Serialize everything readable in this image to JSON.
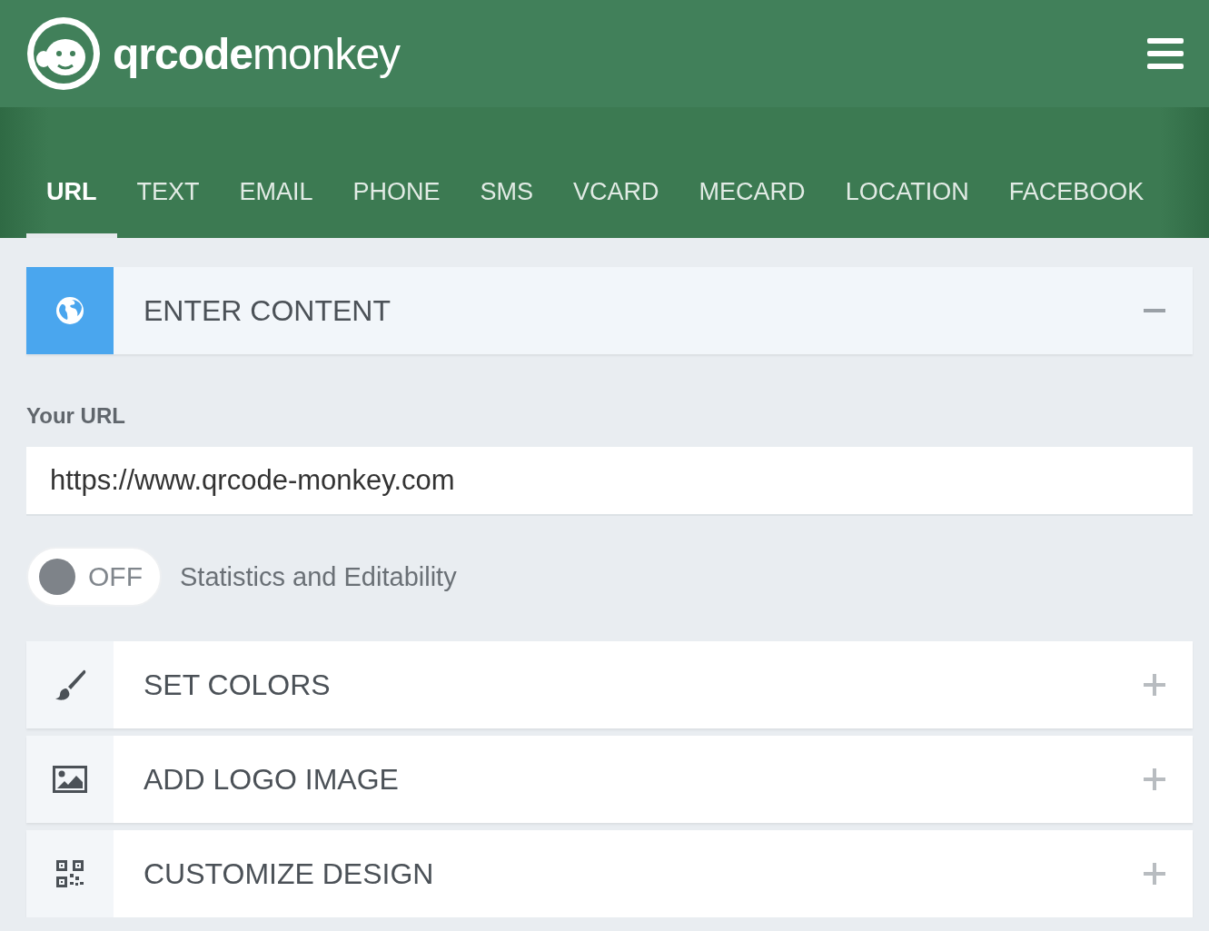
{
  "header": {
    "logo": {
      "bold": "qrcode",
      "light": "monkey"
    }
  },
  "tabs": [
    {
      "label": "URL",
      "selected": true
    },
    {
      "label": "TEXT",
      "selected": false
    },
    {
      "label": "EMAIL",
      "selected": false
    },
    {
      "label": "PHONE",
      "selected": false
    },
    {
      "label": "SMS",
      "selected": false
    },
    {
      "label": "VCARD",
      "selected": false
    },
    {
      "label": "MECARD",
      "selected": false
    },
    {
      "label": "LOCATION",
      "selected": false
    },
    {
      "label": "FACEBOOK",
      "selected": false
    }
  ],
  "sections": [
    {
      "title": "ENTER CONTENT",
      "kind": "globe",
      "expanded": true,
      "form": {
        "label": "Your URL",
        "value": "https://www.qrcode-monkey.com",
        "toggle": {
          "on": false,
          "state_label": "OFF",
          "label": "Statistics and Editability"
        }
      }
    },
    {
      "title": "SET COLORS",
      "kind": "brush",
      "expanded": false
    },
    {
      "title": "ADD LOGO IMAGE",
      "kind": "image",
      "expanded": false
    },
    {
      "title": "CUSTOMIZE DESIGN",
      "kind": "qr",
      "expanded": false
    }
  ]
}
